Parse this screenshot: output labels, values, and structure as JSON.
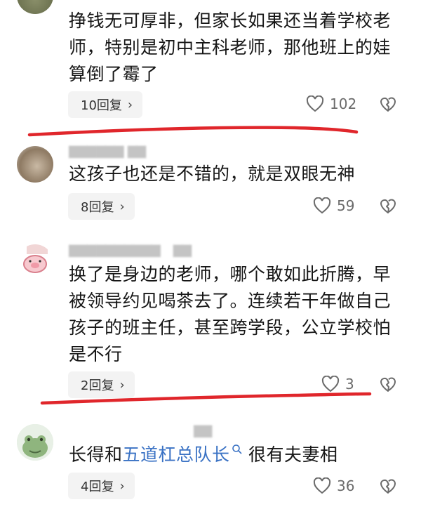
{
  "comments": [
    {
      "text": "挣钱无可厚非，但家长如果还当着学校老师，特别是初中主科老师，那他班上的娃算倒了霉了",
      "reply_label": "10回复",
      "likes": "102"
    },
    {
      "text": "这孩子也还是不错的，就是双眼无神",
      "reply_label": "8回复",
      "likes": "59"
    },
    {
      "text": "换了是身边的老师，哪个敢如此折腾，早被领导约见喝茶去了。连续若干年做自己孩子的班主任，甚至跨学段，公立学校怕是不行",
      "reply_label": "2回复",
      "likes": "3"
    },
    {
      "text_before": "长得和",
      "mention": "五道杠总队长",
      "text_after": " 很有夫妻相",
      "reply_label": "4回复",
      "likes": "36"
    }
  ],
  "annotation_color": "#e0262b",
  "mention_color": "#3a72c4"
}
